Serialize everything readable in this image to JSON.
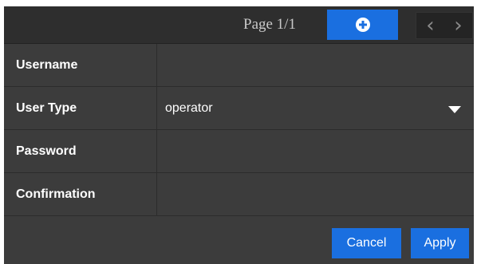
{
  "toolbar": {
    "page_indicator": "Page 1/1",
    "add_icon": "plus-circle-icon",
    "prev_label": "‹",
    "next_label": "›"
  },
  "form": {
    "rows": [
      {
        "label": "Username",
        "value": ""
      },
      {
        "label": "User Type",
        "value": "operator"
      },
      {
        "label": "Password",
        "value": ""
      },
      {
        "label": "Confirmation",
        "value": ""
      }
    ]
  },
  "footer": {
    "cancel_label": "Cancel",
    "apply_label": "Apply"
  },
  "colors": {
    "accent": "#1a6fe0",
    "panel_bg": "#3c3c3c",
    "toolbar_bg": "#2e2e2e"
  }
}
